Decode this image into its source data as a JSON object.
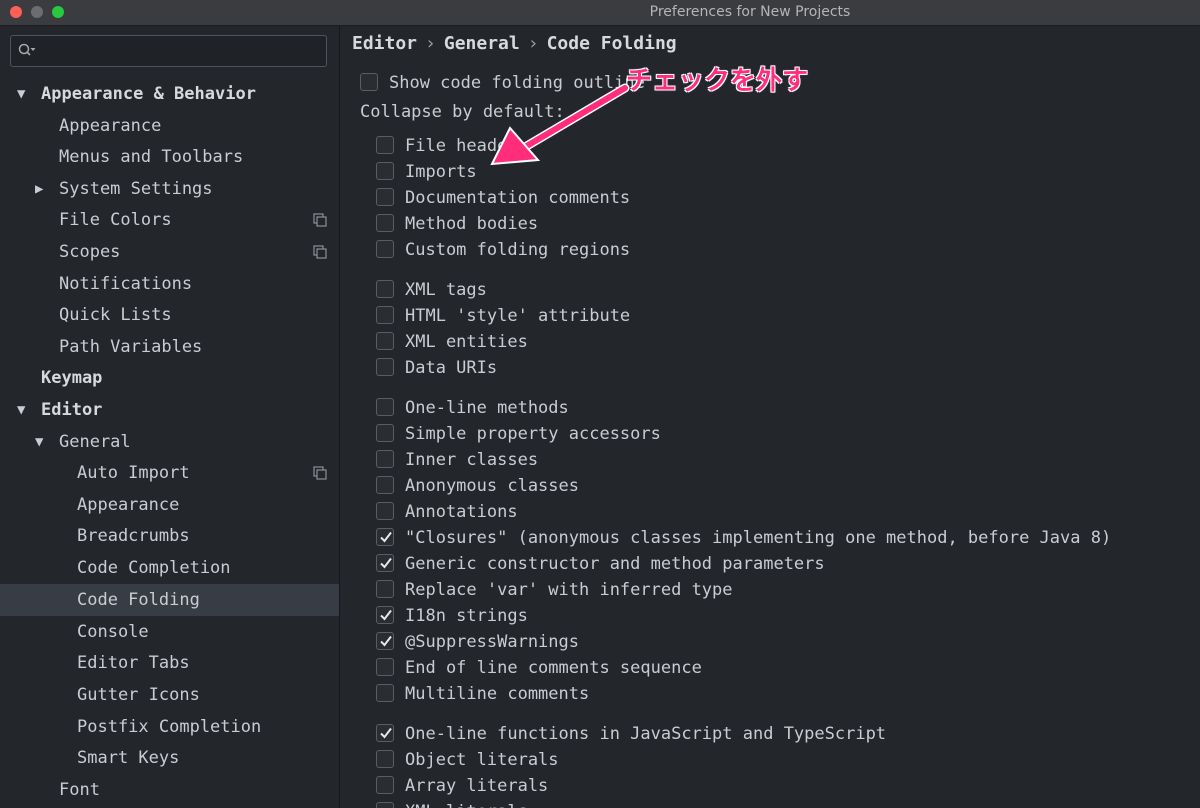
{
  "window": {
    "title": "Preferences for New Projects"
  },
  "search": {
    "placeholder": "",
    "icon": "search-icon"
  },
  "sidebar": {
    "items": [
      {
        "label": "Appearance & Behavior",
        "arrow": "▼"
      },
      {
        "label": "Appearance"
      },
      {
        "label": "Menus and Toolbars"
      },
      {
        "label": "System Settings",
        "arrow": "▶"
      },
      {
        "label": "File Colors",
        "icon": "copy-icon"
      },
      {
        "label": "Scopes",
        "icon": "copy-icon"
      },
      {
        "label": "Notifications"
      },
      {
        "label": "Quick Lists"
      },
      {
        "label": "Path Variables"
      },
      {
        "label": "Keymap"
      },
      {
        "label": "Editor",
        "arrow": "▼"
      },
      {
        "label": "General",
        "arrow": "▼"
      },
      {
        "label": "Auto Import",
        "icon": "copy-icon"
      },
      {
        "label": "Appearance"
      },
      {
        "label": "Breadcrumbs"
      },
      {
        "label": "Code Completion"
      },
      {
        "label": "Code Folding",
        "selected": true
      },
      {
        "label": "Console"
      },
      {
        "label": "Editor Tabs"
      },
      {
        "label": "Gutter Icons"
      },
      {
        "label": "Postfix Completion"
      },
      {
        "label": "Smart Keys"
      },
      {
        "label": "Font"
      }
    ]
  },
  "breadcrumb": {
    "parts": [
      "Editor",
      "General",
      "Code Folding"
    ],
    "separator": "›"
  },
  "settings": {
    "show_outline": {
      "label": "Show code folding outline",
      "checked": false
    },
    "collapse_label": "Collapse by default:",
    "groups": [
      [
        {
          "label": "File header",
          "checked": false
        },
        {
          "label": "Imports",
          "checked": false
        },
        {
          "label": "Documentation comments",
          "checked": false
        },
        {
          "label": "Method bodies",
          "checked": false
        },
        {
          "label": "Custom folding regions",
          "checked": false
        }
      ],
      [
        {
          "label": "XML tags",
          "checked": false
        },
        {
          "label": "HTML 'style' attribute",
          "checked": false
        },
        {
          "label": "XML entities",
          "checked": false
        },
        {
          "label": "Data URIs",
          "checked": false
        }
      ],
      [
        {
          "label": "One-line methods",
          "checked": false
        },
        {
          "label": "Simple property accessors",
          "checked": false
        },
        {
          "label": "Inner classes",
          "checked": false
        },
        {
          "label": "Anonymous classes",
          "checked": false
        },
        {
          "label": "Annotations",
          "checked": false
        },
        {
          "label": "\"Closures\" (anonymous classes implementing one method, before Java 8)",
          "checked": true
        },
        {
          "label": "Generic constructor and method parameters",
          "checked": true
        },
        {
          "label": "Replace 'var' with inferred type",
          "checked": false
        },
        {
          "label": "I18n strings",
          "checked": true
        },
        {
          "label": "@SuppressWarnings",
          "checked": true
        },
        {
          "label": "End of line comments sequence",
          "checked": false
        },
        {
          "label": "Multiline comments",
          "checked": false
        }
      ],
      [
        {
          "label": "One-line functions in JavaScript and TypeScript",
          "checked": true
        },
        {
          "label": "Object literals",
          "checked": false
        },
        {
          "label": "Array literals",
          "checked": false
        },
        {
          "label": "XML literals",
          "checked": false
        }
      ]
    ]
  },
  "annotation": {
    "text": "チェックを外す",
    "color": "#ff2d7a"
  },
  "colors": {
    "background": "#23262b",
    "selection": "#383c44",
    "text": "#c9ccd2"
  }
}
